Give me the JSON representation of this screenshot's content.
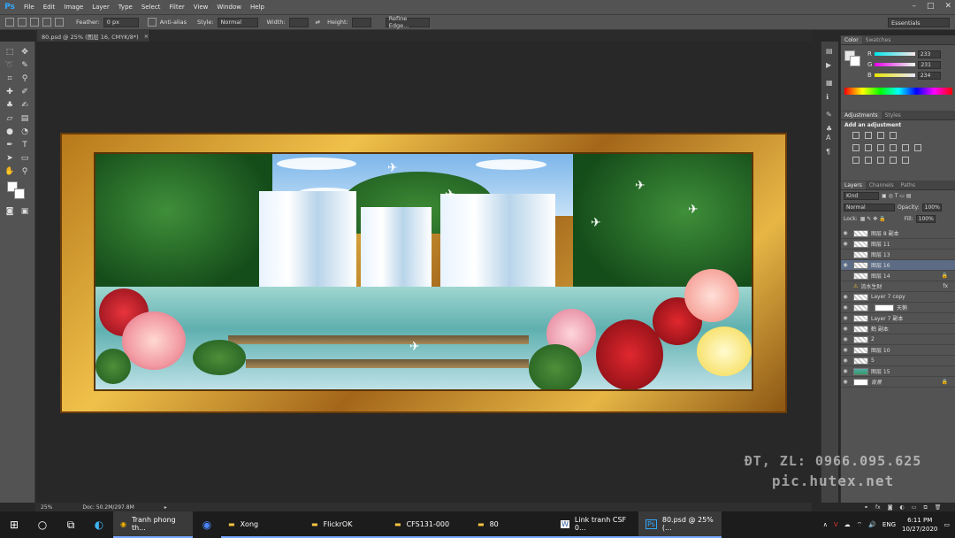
{
  "menubar": {
    "logo": "Ps",
    "items": [
      "File",
      "Edit",
      "Image",
      "Layer",
      "Type",
      "Select",
      "Filter",
      "View",
      "Window",
      "Help"
    ]
  },
  "options": {
    "feather_label": "Feather:",
    "feather_value": "0 px",
    "antialias_label": "Anti-alias",
    "style_label": "Style:",
    "style_value": "Normal",
    "width_label": "Width:",
    "height_label": "Height:",
    "refine_edge": "Refine Edge...",
    "workspace": "Essentials"
  },
  "document_tab": {
    "title": "80.psd @ 25% (图层 16, CMYK/8*)",
    "close": "×"
  },
  "status": {
    "zoom": "25%",
    "doc": "Doc: 50.2M/297.8M"
  },
  "color_panel": {
    "tabs": [
      "Color",
      "Swatches"
    ],
    "r_label": "R",
    "r_value": "233",
    "g_label": "G",
    "g_value": "231",
    "b_label": "B",
    "b_value": "234"
  },
  "adjustments_panel": {
    "tabs": [
      "Adjustments",
      "Styles"
    ],
    "heading": "Add an adjustment"
  },
  "layers_panel": {
    "tabs": [
      "Layers",
      "Channels",
      "Paths"
    ],
    "kind_filter": "Kind",
    "blend_mode": "Normal",
    "opacity_label": "Opacity:",
    "opacity_value": "100%",
    "lock_label": "Lock:",
    "fill_label": "Fill:",
    "fill_value": "100%",
    "layers": [
      {
        "name": "图层 8 副本"
      },
      {
        "name": "图层 11"
      },
      {
        "name": "图层 13"
      },
      {
        "name": "图层 16"
      },
      {
        "name": "图层 14"
      },
      {
        "name": "流水生财"
      },
      {
        "name": "Layer 7 copy"
      },
      {
        "name": "天鹅"
      },
      {
        "name": "Layer 7 副本"
      },
      {
        "name": "鹤 副本"
      },
      {
        "name": "2"
      },
      {
        "name": "图层 10"
      },
      {
        "name": "5"
      },
      {
        "name": "图层 15"
      },
      {
        "name": "背景"
      }
    ]
  },
  "taskbar": {
    "apps": [
      {
        "label": "Tranh phong th..."
      },
      {
        "label": "Xong"
      },
      {
        "label": "FlickrOK"
      },
      {
        "label": "CFS131-000"
      },
      {
        "label": "80"
      },
      {
        "label": "Link tranh CSF 0..."
      },
      {
        "label": "80.psd @ 25% (..."
      }
    ],
    "tray": {
      "lang": "ENG",
      "time": "6:11 PM",
      "date": "10/27/2020"
    }
  },
  "watermark": {
    "line1": "ĐT, ZL: 0966.095.625",
    "line2": "pic.hutex.net"
  }
}
